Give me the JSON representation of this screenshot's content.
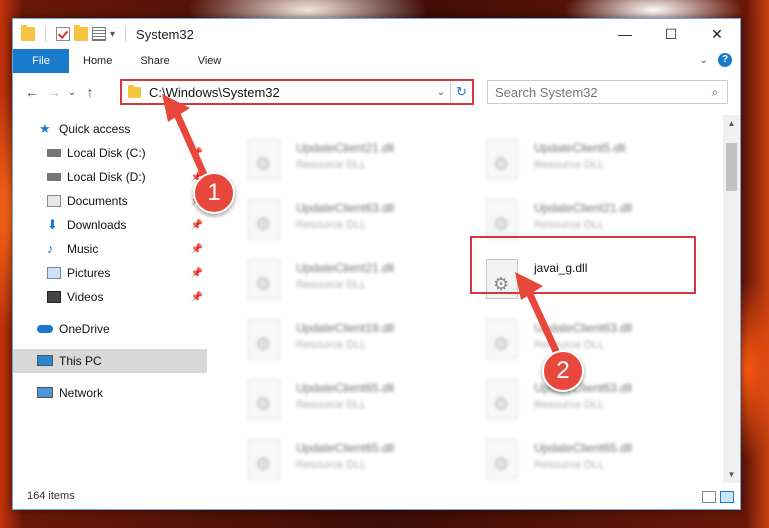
{
  "window": {
    "title": "System32"
  },
  "titlebar": {
    "minimize": "—",
    "maximize": "☐",
    "close": "✕"
  },
  "ribbon": {
    "tabs": [
      "File",
      "Home",
      "Share",
      "View"
    ],
    "collapse": "⌄",
    "help": "?"
  },
  "nav": {
    "back": "←",
    "forward": "→",
    "recent": "⌄",
    "up": "↑"
  },
  "address": {
    "path": "C:\\Windows\\System32",
    "dropdown": "⌄",
    "refresh": "↻"
  },
  "search": {
    "placeholder": "Search System32",
    "icon": "⌕"
  },
  "sidebar": {
    "items": [
      {
        "label": "Quick access",
        "icon": "star-icon",
        "color": "#1979ca"
      },
      {
        "label": "Local Disk (C:)",
        "icon": "drive-icon",
        "pinned": true
      },
      {
        "label": "Local Disk (D:)",
        "icon": "drive-icon",
        "pinned": true
      },
      {
        "label": "Documents",
        "icon": "documents-icon",
        "pinned": true
      },
      {
        "label": "Downloads",
        "icon": "downloads-icon",
        "pinned": true
      },
      {
        "label": "Music",
        "icon": "music-icon",
        "pinned": true
      },
      {
        "label": "Pictures",
        "icon": "pictures-icon",
        "pinned": true
      },
      {
        "label": "Videos",
        "icon": "videos-icon",
        "pinned": true
      },
      {
        "label": "OneDrive",
        "icon": "onedrive-icon"
      },
      {
        "label": "This PC",
        "icon": "pc-icon",
        "selected": true
      },
      {
        "label": "Network",
        "icon": "network-icon"
      }
    ]
  },
  "files": [
    {
      "name": "UpdateClient21.dll",
      "type": "Resource DLL"
    },
    {
      "name": "UpdateClient5.dll",
      "type": "Resource DLL"
    },
    {
      "name": "UpdateClient63.dll",
      "type": "Resource DLL"
    },
    {
      "name": "UpdateClient21.dll",
      "type": "Resource DLL"
    },
    {
      "name": "UpdateClient21.dll",
      "type": "Resource DLL"
    },
    {
      "name": "javai_g.dll",
      "type": ""
    },
    {
      "name": "UpdateClient19.dll",
      "type": "Resource DLL"
    },
    {
      "name": "UpdateClient63.dll",
      "type": "Resource DLL"
    },
    {
      "name": "UpdateClient65.dll",
      "type": "Resource DLL"
    },
    {
      "name": "UpdateClient63.dll",
      "type": "Resource DLL"
    },
    {
      "name": "UpdateClient65.dll",
      "type": "Resource DLL"
    },
    {
      "name": "UpdateClient65.dll",
      "type": "Resource DLL"
    }
  ],
  "status": {
    "item_count": "164 items"
  },
  "annotations": {
    "step1": "1",
    "step2": "2",
    "color": "#e8473c"
  }
}
